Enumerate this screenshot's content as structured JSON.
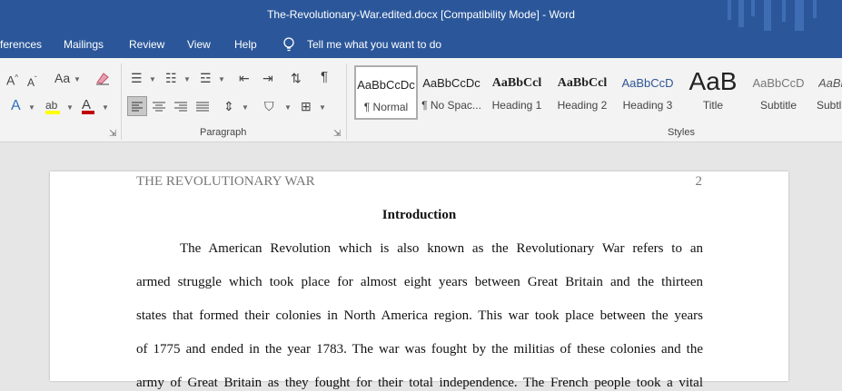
{
  "window": {
    "title": "The-Revolutionary-War.edited.docx [Compatibility Mode]  -  Word"
  },
  "menu": {
    "references": "ferences",
    "mailings": "Mailings",
    "review": "Review",
    "view": "View",
    "help": "Help",
    "tell_me": "Tell me what you want to do"
  },
  "ribbon": {
    "paragraph_label": "Paragraph",
    "styles_label": "Styles",
    "styles": [
      {
        "preview": "AaBbCcDc",
        "label": "¶ Normal"
      },
      {
        "preview": "AaBbCcDc",
        "label": "¶ No Spac..."
      },
      {
        "preview": "AaBbCcl",
        "label": "Heading 1"
      },
      {
        "preview": "AaBbCcl",
        "label": "Heading 2"
      },
      {
        "preview": "AaBbCcD",
        "label": "Heading 3"
      },
      {
        "preview": "AaB",
        "label": "Title"
      },
      {
        "preview": "AaBbCcD",
        "label": "Subtitle"
      },
      {
        "preview": "AaBbC",
        "label": "Subtl"
      }
    ]
  },
  "document": {
    "header_left": "THE REVOLUTIONARY WAR",
    "page_number": "2",
    "heading": "Introduction",
    "lines": [
      "The American Revolution which is also known as the Revolutionary War refers to an",
      "armed struggle which took place for almost eight years between Great Britain and the thirteen",
      "states that formed their colonies in North America region. This war took place between the years",
      "of 1775 and ended in the year 1783. The war was fought by the militias of these colonies and the",
      "army of Great Britain as they fought for their total independence. The French people took a vital"
    ]
  },
  "colors": {
    "accent": "#2b579a",
    "font_color": "#c00000",
    "highlight": "#ffff00"
  }
}
